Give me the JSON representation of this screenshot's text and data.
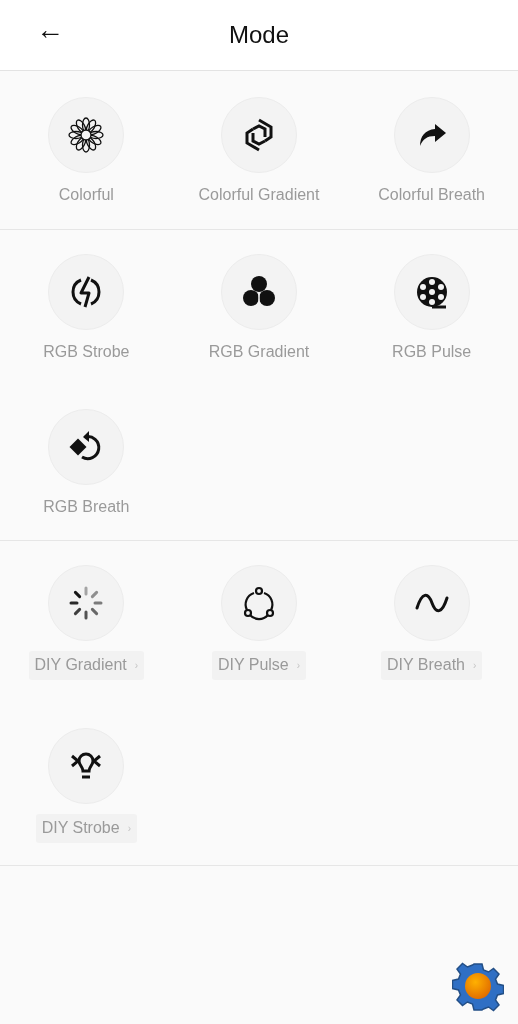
{
  "header": {
    "back": "←",
    "title": "Mode"
  },
  "sections": [
    {
      "items": [
        {
          "label": "Colorful",
          "kind": "preset"
        },
        {
          "label": "Colorful Gradient",
          "kind": "preset"
        },
        {
          "label": "Colorful Breath",
          "kind": "preset"
        }
      ]
    },
    {
      "items": [
        {
          "label": "RGB Strobe",
          "kind": "preset"
        },
        {
          "label": "RGB Gradient",
          "kind": "preset"
        },
        {
          "label": "RGB Pulse",
          "kind": "preset"
        },
        {
          "label": "RGB Breath",
          "kind": "preset"
        }
      ]
    },
    {
      "items": [
        {
          "label": "DIY Gradient",
          "kind": "diy",
          "chevron": "›"
        },
        {
          "label": "DIY Pulse",
          "kind": "diy",
          "chevron": "›"
        },
        {
          "label": "DIY Breath",
          "kind": "diy",
          "chevron": "›"
        },
        {
          "label": "DIY Strobe",
          "kind": "diy",
          "chevron": "›"
        }
      ]
    }
  ]
}
